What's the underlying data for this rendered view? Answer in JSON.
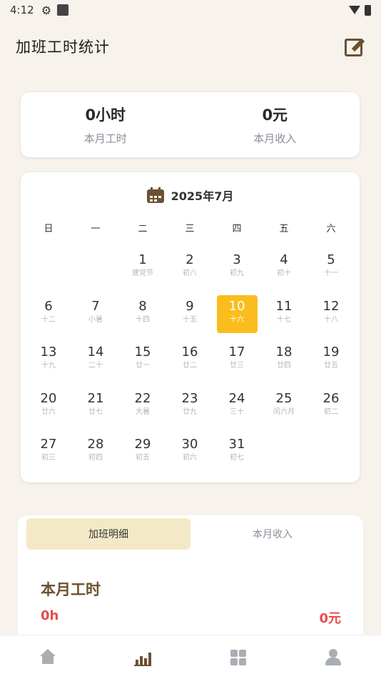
{
  "status_bar": {
    "time": "4:12"
  },
  "app_bar": {
    "title": "加班工时统计"
  },
  "summary": {
    "hours_value": "0小时",
    "hours_label": "本月工时",
    "income_value": "0元",
    "income_label": "本月收入"
  },
  "calendar": {
    "title": "2025年7月",
    "weekdays": [
      "日",
      "一",
      "二",
      "三",
      "四",
      "五",
      "六"
    ],
    "leading_blanks": 2,
    "today": 10,
    "days": [
      {
        "num": "1",
        "lunar": "建党节"
      },
      {
        "num": "2",
        "lunar": "初八"
      },
      {
        "num": "3",
        "lunar": "初九"
      },
      {
        "num": "4",
        "lunar": "初十"
      },
      {
        "num": "5",
        "lunar": "十一"
      },
      {
        "num": "6",
        "lunar": "十二"
      },
      {
        "num": "7",
        "lunar": "小暑"
      },
      {
        "num": "8",
        "lunar": "十四"
      },
      {
        "num": "9",
        "lunar": "十五"
      },
      {
        "num": "10",
        "lunar": "十六"
      },
      {
        "num": "11",
        "lunar": "十七"
      },
      {
        "num": "12",
        "lunar": "十八"
      },
      {
        "num": "13",
        "lunar": "十九"
      },
      {
        "num": "14",
        "lunar": "二十"
      },
      {
        "num": "15",
        "lunar": "廿一"
      },
      {
        "num": "16",
        "lunar": "廿二"
      },
      {
        "num": "17",
        "lunar": "廿三"
      },
      {
        "num": "18",
        "lunar": "廿四"
      },
      {
        "num": "19",
        "lunar": "廿五"
      },
      {
        "num": "20",
        "lunar": "廿六"
      },
      {
        "num": "21",
        "lunar": "廿七"
      },
      {
        "num": "22",
        "lunar": "大暑"
      },
      {
        "num": "23",
        "lunar": "廿九"
      },
      {
        "num": "24",
        "lunar": "三十"
      },
      {
        "num": "25",
        "lunar": "闰六月"
      },
      {
        "num": "26",
        "lunar": "初二"
      },
      {
        "num": "27",
        "lunar": "初三"
      },
      {
        "num": "28",
        "lunar": "初四"
      },
      {
        "num": "29",
        "lunar": "初五"
      },
      {
        "num": "30",
        "lunar": "初六"
      },
      {
        "num": "31",
        "lunar": "初七"
      }
    ]
  },
  "detail": {
    "tabs": [
      {
        "label": "加班明细",
        "active": true
      },
      {
        "label": "本月收入",
        "active": false
      }
    ],
    "title": "本月工时",
    "hours": "0h",
    "income": "0元"
  },
  "bottom_nav": [
    {
      "icon": "home-icon",
      "active": false
    },
    {
      "icon": "chart-icon",
      "active": true
    },
    {
      "icon": "calculator-icon",
      "active": false
    },
    {
      "icon": "user-icon",
      "active": false
    }
  ],
  "colors": {
    "background": "#f7f2ec",
    "accent_brown": "#6b5230",
    "today_highlight": "#fbbd1e",
    "active_tab_bg": "#f4e9c7",
    "negative_red": "#e74b4b",
    "muted_icon": "#a9aeb5"
  }
}
